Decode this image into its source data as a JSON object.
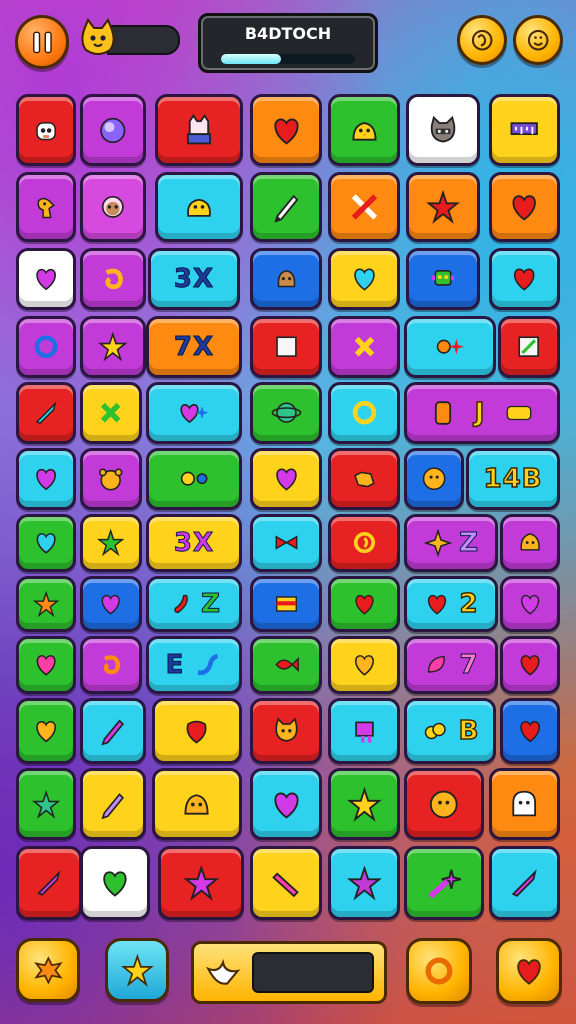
{
  "hud": {
    "title": "B4DTOCH",
    "title_progress": 0.45,
    "mini_progress": 0.0,
    "pause_icon": "pause-icon",
    "character_icon": "cat-face-icon",
    "right_buttons": [
      "smile-icon",
      "face-icon"
    ]
  },
  "board": {
    "labels": {
      "r2c2": "3X",
      "r3c2": "7X",
      "r4c5": "J",
      "r5c5": "14B",
      "r6c2": "3X",
      "r6c5": "Z",
      "r7c2": "Z",
      "r7c5": "2",
      "r8c2": "E",
      "r8c5": "7",
      "r9c5": "B"
    }
  },
  "footer": {
    "buttons": [
      "splat-icon",
      "star-icon",
      "ring-icon",
      "heart-icon"
    ],
    "booster_icon": "bird-icon",
    "booster_progress": 0.0
  }
}
